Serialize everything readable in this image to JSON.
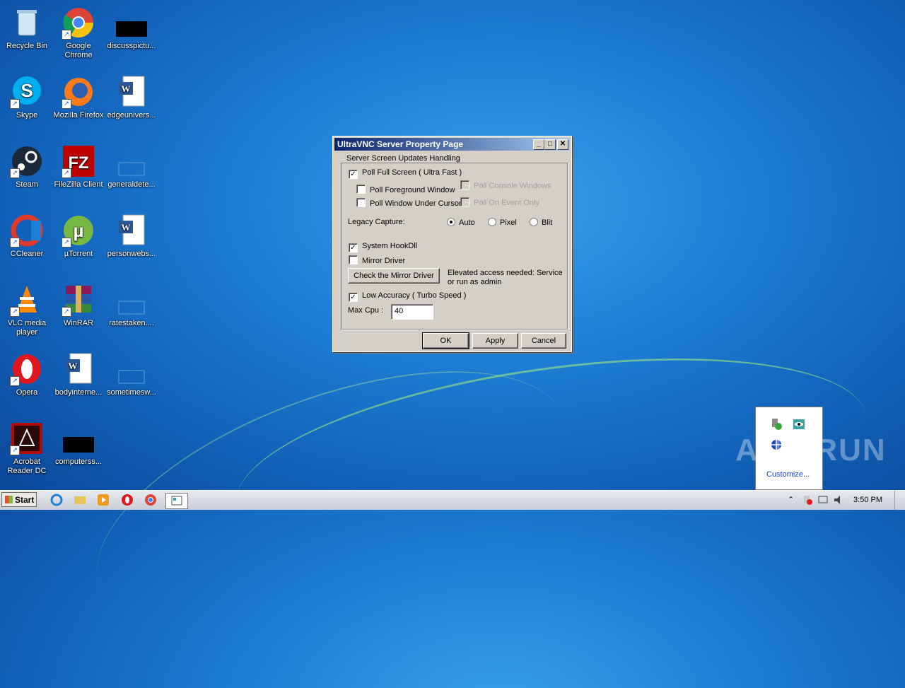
{
  "desktop": {
    "icons": [
      {
        "label": "Recycle Bin"
      },
      {
        "label": "Google Chrome"
      },
      {
        "label": "discusspictu..."
      },
      {
        "label": "Skype"
      },
      {
        "label": "Mozilla Firefox"
      },
      {
        "label": "edgeunivers..."
      },
      {
        "label": "Steam"
      },
      {
        "label": "FileZilla Client"
      },
      {
        "label": "generaldete..."
      },
      {
        "label": "CCleaner"
      },
      {
        "label": "µTorrent"
      },
      {
        "label": "personwebs..."
      },
      {
        "label": "VLC media player"
      },
      {
        "label": "WinRAR"
      },
      {
        "label": "ratestaken...."
      },
      {
        "label": "Opera"
      },
      {
        "label": "bodyinterne..."
      },
      {
        "label": "sometimesw..."
      },
      {
        "label": "Acrobat Reader DC"
      },
      {
        "label": "computerss..."
      }
    ]
  },
  "dialog": {
    "title": "UltraVNC Server Property Page",
    "group_label": "Server Screen Updates Handling",
    "poll_full_screen": {
      "label": "Poll Full Screen ( Ultra Fast )",
      "checked": true
    },
    "poll_foreground": {
      "label": "Poll Foreground Window",
      "checked": false
    },
    "poll_under_cursor": {
      "label": "Poll Window Under Cursor",
      "checked": false
    },
    "poll_console": {
      "label": "Poll Console Windows Only",
      "checked": false
    },
    "poll_on_event": {
      "label": "Poll On Event Only",
      "checked": false
    },
    "legacy_capture_label": "Legacy Capture:",
    "capture_options": [
      "Auto",
      "Pixel",
      "Blit"
    ],
    "capture_selected": "Auto",
    "system_hookdll": {
      "label": "System HookDll",
      "checked": true
    },
    "mirror_driver": {
      "label": "Mirror Driver",
      "checked": false
    },
    "check_mirror_button": "Check the Mirror Driver",
    "elevated_note": "Elevated access needed: Service or run as admin",
    "low_accuracy": {
      "label": "Low Accuracy ( Turbo Speed )",
      "checked": true
    },
    "max_cpu_label": "Max Cpu :",
    "max_cpu_value": "40",
    "ok_button": "OK",
    "apply_button": "Apply",
    "cancel_button": "Cancel"
  },
  "tray_popup": {
    "customize_link": "Customize..."
  },
  "taskbar": {
    "start_label": "Start",
    "clock": "3:50 PM"
  },
  "watermark": "ANY RUN"
}
